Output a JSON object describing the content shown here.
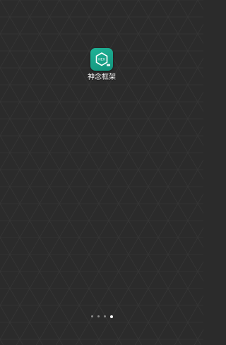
{
  "home_screen": {
    "apps": [
      {
        "label": "神念框架",
        "icon": "hexagon-framework-icon",
        "icon_text": "HEX",
        "accent_color": "#16a085"
      }
    ],
    "page_indicator": {
      "total_pages": 4,
      "current_page": 4
    },
    "background_color": "#2b2b2b"
  }
}
